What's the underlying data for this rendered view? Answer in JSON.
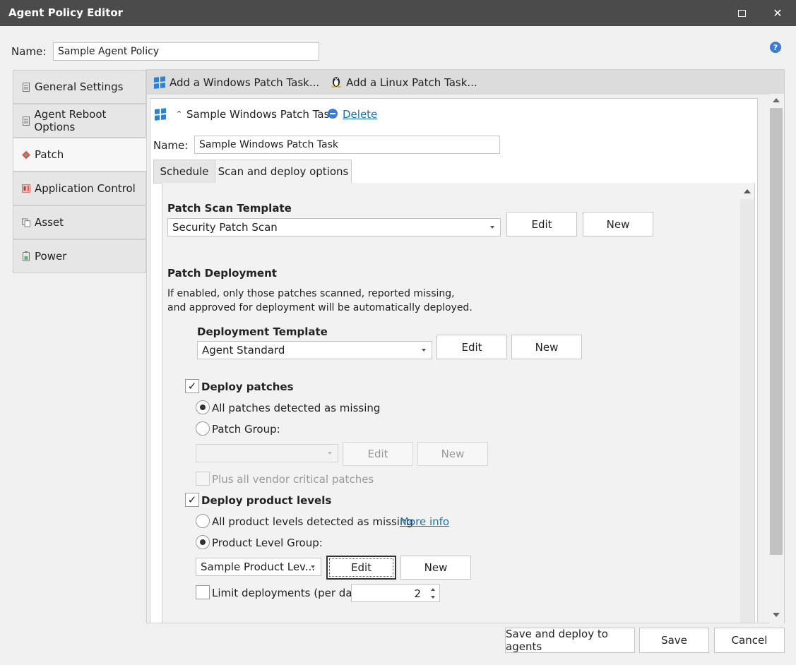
{
  "window": {
    "title": "Agent Policy Editor",
    "maximize_icon": "maximize-icon",
    "close_icon": "close-icon",
    "close_glyph": "✕"
  },
  "help": {
    "icon": "help-icon",
    "glyph": "?"
  },
  "policy": {
    "name_label": "Name:",
    "name_value": "Sample Agent Policy"
  },
  "sidebar": {
    "items": [
      {
        "label": "General Settings",
        "icon": "document-icon",
        "active": false
      },
      {
        "label": "Agent Reboot Options",
        "icon": "document-icon",
        "active": false
      },
      {
        "label": "Patch",
        "icon": "patch-icon",
        "active": true
      },
      {
        "label": "Application Control",
        "icon": "application-control-icon",
        "active": false
      },
      {
        "label": "Asset",
        "icon": "asset-icon",
        "active": false
      },
      {
        "label": "Power",
        "icon": "power-icon",
        "active": false
      }
    ]
  },
  "toolbar": {
    "add_windows": "Add a Windows Patch Task...",
    "add_linux": "Add a Linux Patch Task..."
  },
  "task": {
    "title": "Sample Windows Patch Task",
    "delete_label": "Delete",
    "name_label": "Name:",
    "name_value": "Sample Windows Patch Task",
    "tabs": [
      "Schedule",
      "Scan and deploy options"
    ],
    "active_tab": "Scan and deploy options"
  },
  "scan": {
    "heading": "Patch Scan Template",
    "template_value": "Security Patch Scan",
    "edit_label": "Edit",
    "new_label": "New"
  },
  "deployment": {
    "heading": "Patch Deployment",
    "desc_line1": "If enabled, only those patches scanned, reported missing,",
    "desc_line2": "and approved for deployment will be automatically deployed.",
    "template_heading": "Deployment Template",
    "template_value": "Agent Standard",
    "edit_label": "Edit",
    "new_label": "New"
  },
  "deploy_patches": {
    "label": "Deploy patches",
    "checked": true,
    "option_all": "All patches detected as missing",
    "option_group": "Patch Group:",
    "selected": "all",
    "group_value": "",
    "edit_label": "Edit",
    "new_label": "New",
    "plus_critical": "Plus all vendor critical patches"
  },
  "deploy_levels": {
    "label": "Deploy product levels",
    "checked": true,
    "option_all": "All product levels detected as missing",
    "more_info": "More info",
    "option_group": "Product Level Group:",
    "selected": "group",
    "group_value": "Sample Product Lev...",
    "edit_label": "Edit",
    "new_label": "New",
    "limit_label": "Limit deployments (per day)",
    "limit_checked": false,
    "limit_value": "2"
  },
  "footer": {
    "save_deploy": "Save and deploy to agents",
    "save": "Save",
    "cancel": "Cancel"
  }
}
